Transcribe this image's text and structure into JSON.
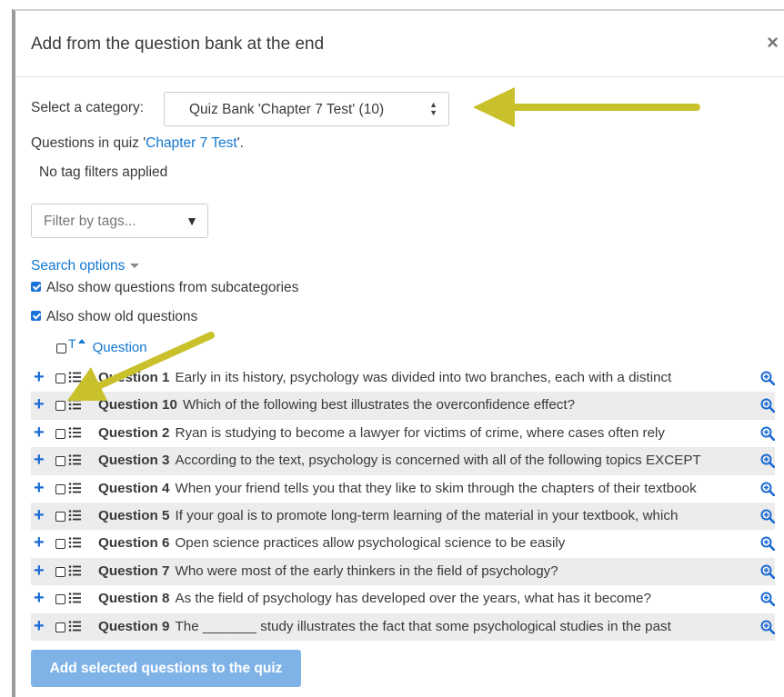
{
  "modal": {
    "title": "Add from the question bank at the end",
    "close_glyph": "×"
  },
  "category": {
    "label": "Select a category:",
    "selected": "Quiz Bank 'Chapter 7 Test' (10)"
  },
  "quiz_info": {
    "prefix": "Questions in quiz '",
    "quiz_name": "Chapter 7 Test",
    "suffix": "'."
  },
  "tags": {
    "status": "No tag filters applied",
    "filter_placeholder": "Filter by tags..."
  },
  "search_options": {
    "label": "Search options",
    "subcategories": {
      "label": "Also show questions from subcategories",
      "checked": true
    },
    "old_questions": {
      "label": "Also show old questions",
      "checked": true
    }
  },
  "table": {
    "type_header": "T",
    "question_header": "Question",
    "rows": [
      {
        "name": "Question 1",
        "text": "Early in its history, psychology was divided into two branches, each with a distinct"
      },
      {
        "name": "Question 10",
        "text": "Which of the following best illustrates the overconfidence effect?"
      },
      {
        "name": "Question 2",
        "text": "Ryan is studying to become a lawyer for victims of crime, where cases often rely"
      },
      {
        "name": "Question 3",
        "text": "According to the text, psychology is concerned with all of the following topics EXCEPT"
      },
      {
        "name": "Question 4",
        "text": "When your friend tells you that they like to skim through the chapters of their textbook"
      },
      {
        "name": "Question 5",
        "text": "If your goal is to promote long-term learning of the material in your textbook, which"
      },
      {
        "name": "Question 6",
        "text": "Open science practices allow psychological science to be easily"
      },
      {
        "name": "Question 7",
        "text": "Who were most of the early thinkers in the field of psychology?"
      },
      {
        "name": "Question 8",
        "text": "As the field of psychology has developed over the years, what has it become?"
      },
      {
        "name": "Question 9",
        "text": "The _______ study illustrates the fact that some psychological studies in the past"
      }
    ]
  },
  "actions": {
    "add_selected": "Add selected questions to the quiz"
  },
  "colors": {
    "link": "#1177d1",
    "button": "#7fb3e8",
    "annotation_arrow": "#c8c12b",
    "row_alt": "#ececec"
  }
}
